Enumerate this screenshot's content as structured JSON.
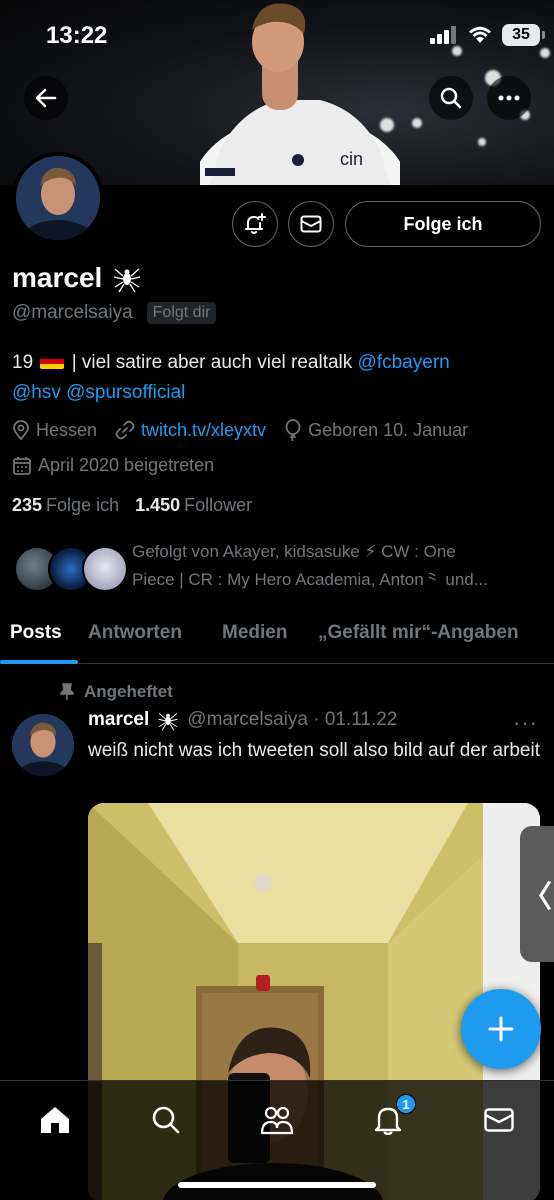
{
  "status_bar": {
    "time": "13:22",
    "battery": "35"
  },
  "profile": {
    "name": "marcel",
    "handle": "@marcelsaiya",
    "follows_you_badge": "Folgt dir",
    "follow_button": "Folge ich",
    "bio_prefix": "19",
    "bio_text": " | viel satire aber auch viel realtalk ",
    "bio_mention_1": "@fcbayern",
    "bio_mention_2": "@hsv",
    "bio_mention_3": "@spursofficial",
    "location": "Hessen",
    "website": "twitch.tv/xleyxtv",
    "birthday": "Geboren 10. Januar",
    "joined": "April 2020 beigetreten",
    "following_count": "235",
    "following_label": "Folge ich",
    "followers_count": "1.450",
    "followers_label": "Follower",
    "followed_by_line1": "Gefolgt von Akayer, kidsasuke ⚡ CW : One",
    "followed_by_line2": "Piece | CR : My Hero Academia, Anton⺀ und..."
  },
  "tabs": [
    {
      "label": "Posts",
      "active": true
    },
    {
      "label": "Antworten",
      "active": false
    },
    {
      "label": "Medien",
      "active": false
    },
    {
      "label": "„Gefällt mir“-Angaben",
      "active": false
    }
  ],
  "pinned_post": {
    "pinned_label": "Angeheftet",
    "author_name": "marcel",
    "author_handle": "@marcelsaiya · 01.11.22",
    "text": "weiß nicht was ich tweeten soll also bild auf der arbeit",
    "more": "···"
  },
  "side_handle": "〈",
  "notification_badge": "1",
  "icons": [
    "back-arrow-icon",
    "search-icon",
    "more-icon",
    "notification-add-icon",
    "mail-icon",
    "spider-icon",
    "location-icon",
    "link-icon",
    "balloon-icon",
    "calendar-icon",
    "pin-icon",
    "plus-icon",
    "home-icon",
    "communities-icon",
    "bell-icon"
  ],
  "colors": {
    "accent": "#1d9bf0",
    "muted": "#71767b",
    "background": "#000000",
    "divider": "#2f3336"
  }
}
